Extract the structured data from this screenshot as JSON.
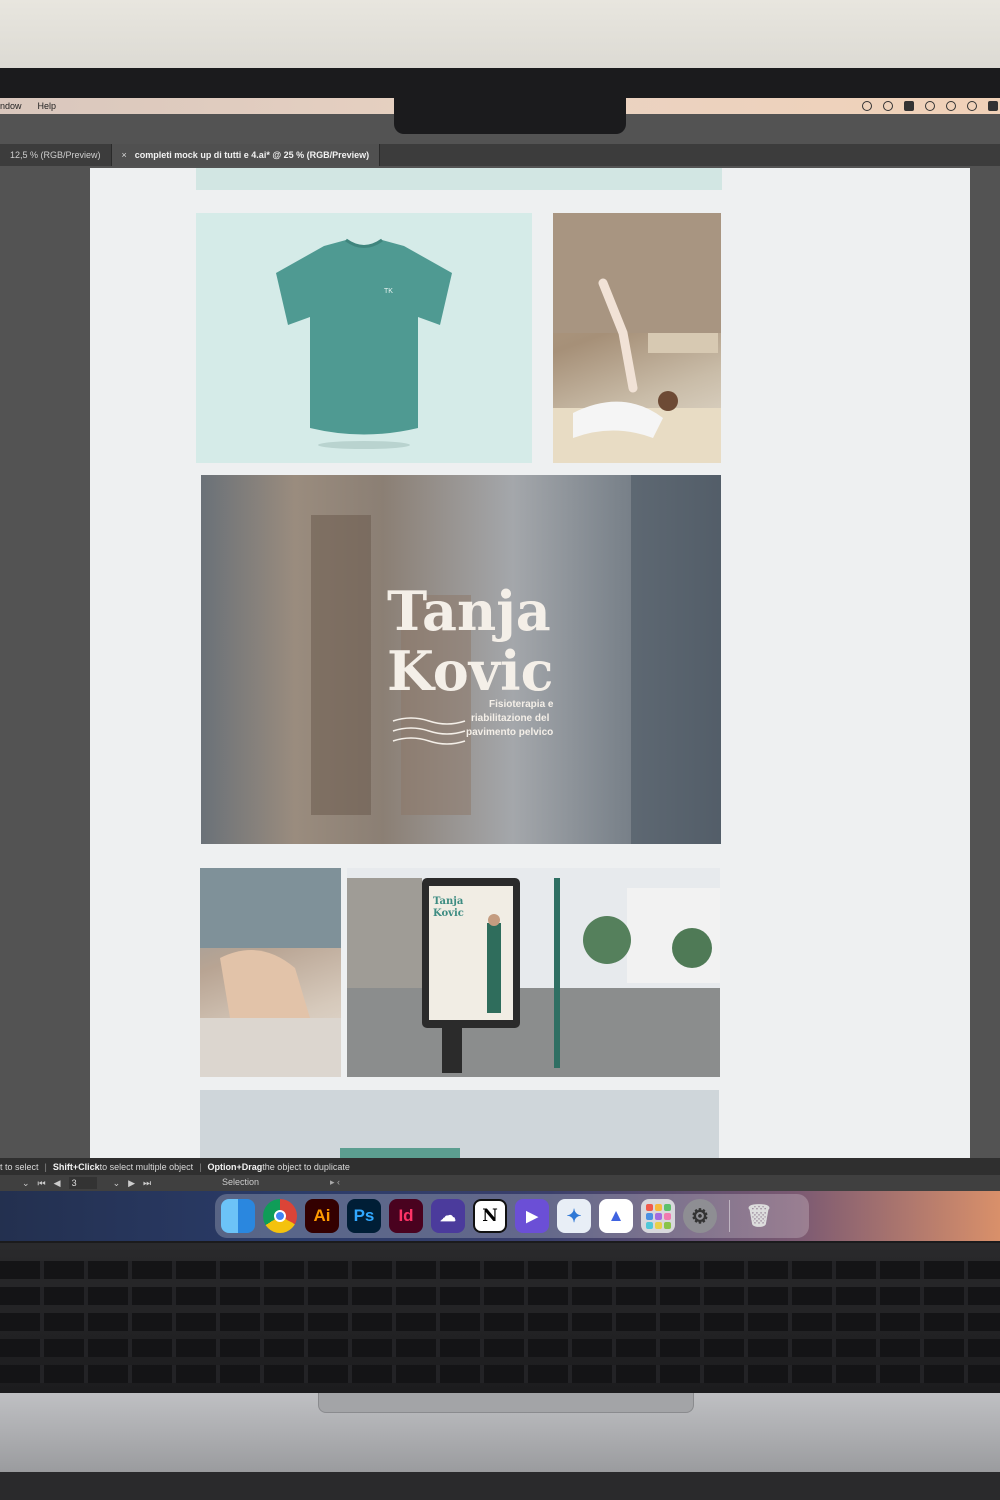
{
  "menubar": {
    "items": [
      "ndow",
      "Help"
    ]
  },
  "tabs": [
    {
      "label": "12,5 % (RGB/Preview)"
    },
    {
      "close": "×",
      "label": "completi mock up di tutti e 4.ai* @ 25 % (RGB/Preview)"
    }
  ],
  "artboard": {
    "images": [
      "teal-tshirt-mockup",
      "physiotherapy-session-photo",
      "window-sign-mockup",
      "massage-photo",
      "street-billboard-mockup",
      "building-sky-photo"
    ]
  },
  "hint_bar": {
    "part1": "t to select",
    "sep1": "|",
    "part2_key": "Shift+Click",
    "part2": " to select multiple object",
    "sep2": "|",
    "part3_key": "Option+Drag",
    "part3": " the object to duplicate"
  },
  "bottom_bar": {
    "page_number": "3",
    "tool": "Selection"
  },
  "dock": {
    "apps": [
      {
        "name": "Finder",
        "glyph": ""
      },
      {
        "name": "Google Chrome",
        "glyph": ""
      },
      {
        "name": "Adobe Illustrator",
        "glyph": "Ai"
      },
      {
        "name": "Adobe Photoshop",
        "glyph": "Ps"
      },
      {
        "name": "Adobe InDesign",
        "glyph": "Id"
      },
      {
        "name": "Creative Cloud",
        "glyph": "☁"
      },
      {
        "name": "Notion",
        "glyph": "N"
      },
      {
        "name": "Video Player",
        "glyph": "▶"
      },
      {
        "name": "Xcode",
        "glyph": "✦"
      },
      {
        "name": "NordVPN",
        "glyph": "▲"
      },
      {
        "name": "Launchpad",
        "glyph": ""
      },
      {
        "name": "System Settings",
        "glyph": "⚙"
      },
      {
        "name": "Trash",
        "glyph": "🗑"
      }
    ]
  },
  "colors": {
    "accent_teal": "#5f9e98",
    "menubar_peach": "#ead3c2"
  }
}
